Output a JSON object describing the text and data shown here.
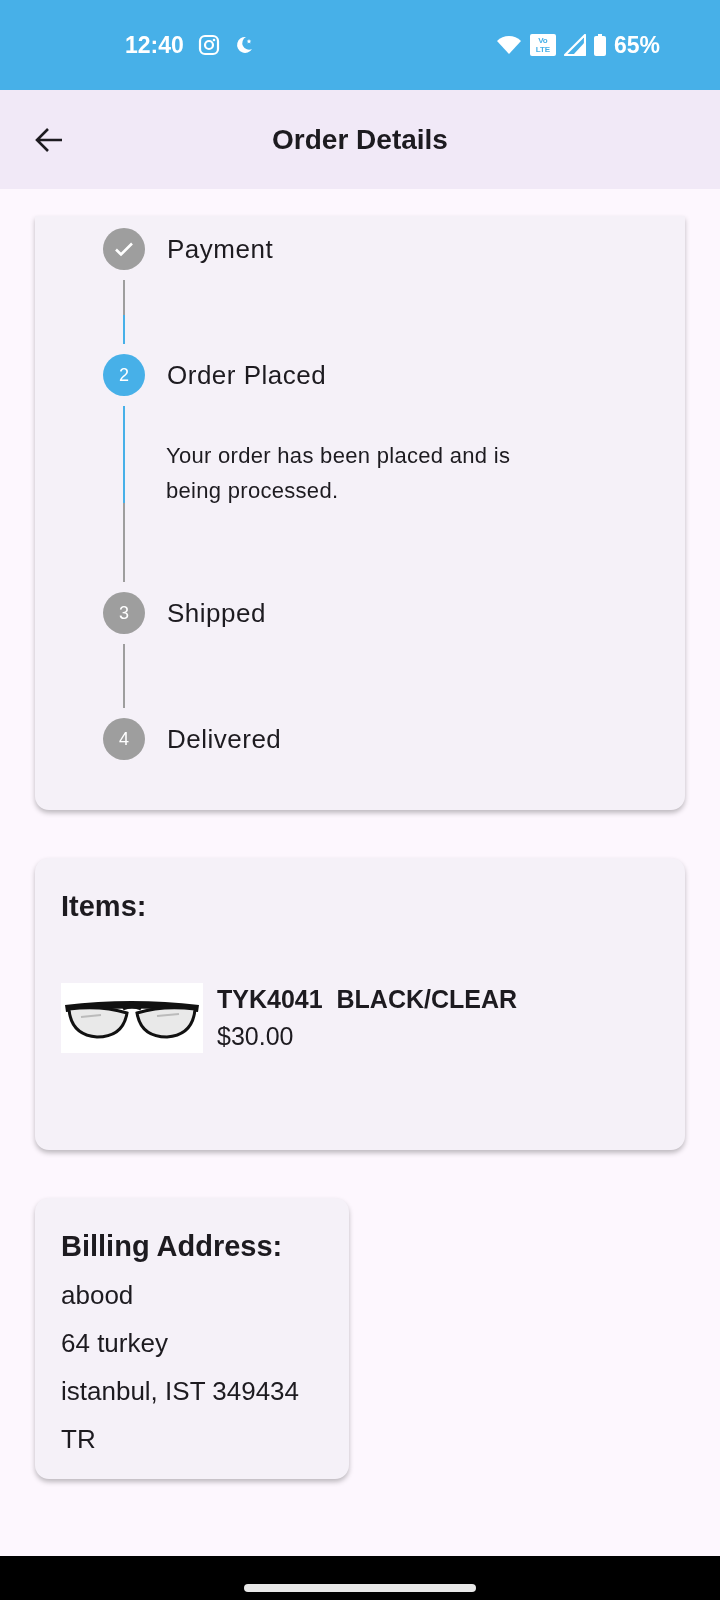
{
  "status_bar": {
    "time": "12:40",
    "network_badge": "Vo LTE",
    "battery": "65%"
  },
  "app_bar": {
    "title": "Order Details"
  },
  "order_steps": [
    {
      "label": "Payment",
      "kind": "complete"
    },
    {
      "label": "Order Placed",
      "marker": "2",
      "kind": "active",
      "description": "Your order has been placed and is being processed."
    },
    {
      "label": "Shipped",
      "marker": "3",
      "kind": "pending"
    },
    {
      "label": "Delivered",
      "marker": "4",
      "kind": "pending"
    }
  ],
  "items": {
    "heading": "Items:",
    "list": [
      {
        "kind": "picture",
        "name": "TYK4041  BLACK/CLEAR",
        "price": "$30.00"
      }
    ]
  },
  "billing": {
    "heading": "Billing Address:",
    "lines": [
      "abood",
      "64 turkey",
      "istanbul, IST 349434",
      "TR"
    ]
  }
}
